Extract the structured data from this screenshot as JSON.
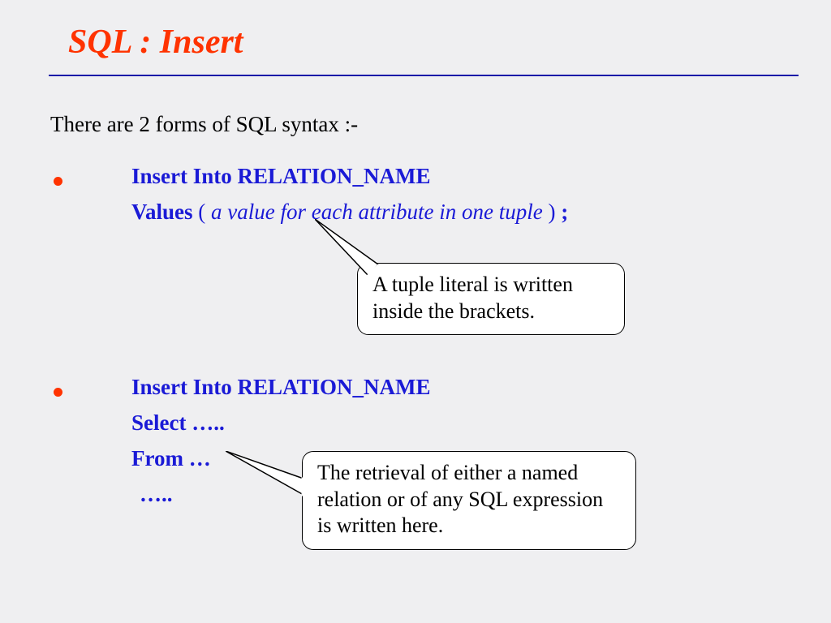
{
  "title": "SQL : Insert",
  "intro": "There are 2 forms of SQL syntax :-",
  "form1": {
    "insert_into": "Insert Into  ",
    "relation": "RELATION_NAME",
    "values": "Values ",
    "open_paren": "( ",
    "value_desc": "a value for each attribute in one tuple",
    "close_paren": " ) ",
    "semicolon": ";"
  },
  "callout1": "A tuple literal is written inside the brackets.",
  "form2": {
    "insert_into": "Insert Into  ",
    "relation": "RELATION_NAME",
    "select": "Select  …..",
    "from": "From  …",
    "dots": "….."
  },
  "callout2": "The retrieval of either a named relation or of any SQL expression is written here."
}
